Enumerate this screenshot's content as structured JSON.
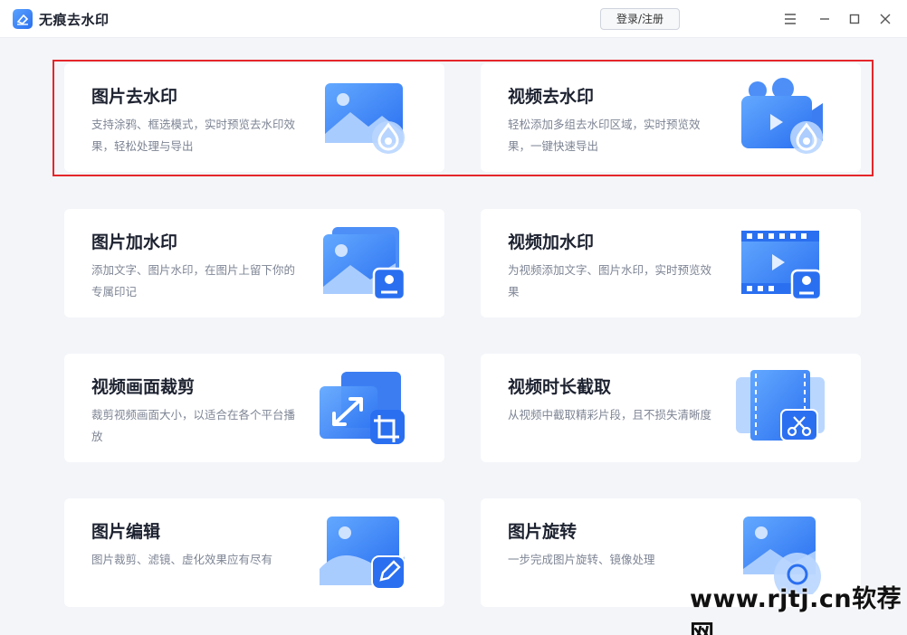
{
  "app": {
    "title": "无痕去水印",
    "logo_icon": "eraser-icon"
  },
  "header": {
    "login_label": "登录/注册"
  },
  "window_controls": [
    "menu-icon",
    "minimize-icon",
    "maximize-icon",
    "close-icon"
  ],
  "cards": [
    {
      "title": "图片去水印",
      "desc": "支持涂鸦、框选模式，实时预览去水印效果，轻松处理与导出",
      "icon": "image-remove-watermark-icon"
    },
    {
      "title": "视频去水印",
      "desc": "轻松添加多组去水印区域，实时预览效果，一键快速导出",
      "icon": "video-remove-watermark-icon"
    },
    {
      "title": "图片加水印",
      "desc": "添加文字、图片水印，在图片上留下你的专属印记",
      "icon": "image-add-watermark-icon"
    },
    {
      "title": "视频加水印",
      "desc": "为视频添加文字、图片水印，实时预览效果",
      "icon": "video-add-watermark-icon"
    },
    {
      "title": "视频画面裁剪",
      "desc": "裁剪视频画面大小，以适合在各个平台播放",
      "icon": "video-crop-icon"
    },
    {
      "title": "视频时长截取",
      "desc": "从视频中截取精彩片段，且不损失清晰度",
      "icon": "video-trim-icon"
    },
    {
      "title": "图片编辑",
      "desc": "图片裁剪、滤镜、虚化效果应有尽有",
      "icon": "image-edit-icon"
    },
    {
      "title": "图片旋转",
      "desc": "一步完成图片旋转、镜像处理",
      "icon": "image-rotate-icon"
    }
  ],
  "watermark_text": "www.rjtj.cn软荐网",
  "colors": {
    "accent": "#2a6ff0",
    "highlight": "#e5262b"
  }
}
